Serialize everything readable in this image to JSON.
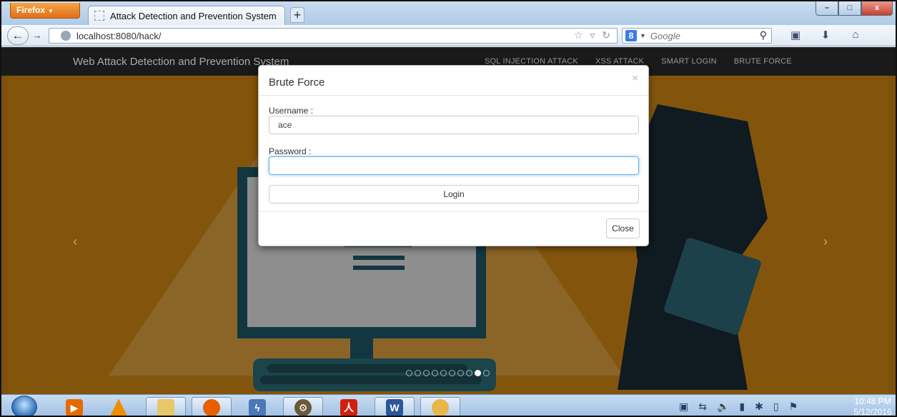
{
  "browser": {
    "menu_button": "Firefox",
    "tab_title": "Attack Detection and Prevention System",
    "new_tab_glyph": "+",
    "url": "localhost:8080/hack/",
    "search_engine_letter": "8",
    "search_placeholder": "Google",
    "window_controls": {
      "minimize": "–",
      "maximize": "□",
      "close": "x"
    }
  },
  "site": {
    "brand": "Web Attack Detection and Prevention System",
    "nav": [
      "SQL INJECTION ATTACK",
      "XSS ATTACK",
      "SMART LOGIN",
      "BRUTE FORCE"
    ]
  },
  "carousel": {
    "prev_glyph": "‹",
    "next_glyph": "›",
    "slide_count": 10,
    "active_index": 8
  },
  "modal": {
    "title": "Brute Force",
    "close_glyph": "×",
    "username_label": "Username :",
    "username_value": "ace",
    "password_label": "Password :",
    "password_value": "",
    "login_label": "Login",
    "close_label": "Close"
  },
  "taskbar": {
    "apps": [
      "media-player-icon",
      "vlc-icon",
      "file-explorer-icon",
      "firefox-icon",
      "flashget-icon",
      "settings-gear-icon",
      "acrobat-reader-icon",
      "word-icon",
      "paint-icon"
    ],
    "clock_time": "10:48 PM",
    "clock_date": "5/12/2016"
  },
  "colors": {
    "page_background": "#ce8212",
    "site_nav": "#1a1a1a",
    "monitor": "#1e5a6a",
    "focus_ring": "#66afe9"
  }
}
